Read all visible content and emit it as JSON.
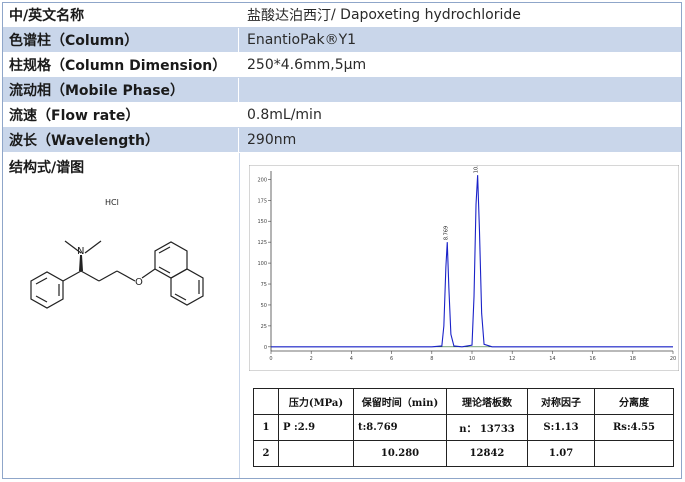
{
  "rows": [
    {
      "key": "中/英文名称",
      "value_cn": "盐酸达泊西汀",
      "value_en": "/ Dapoxeting hydrochloride"
    },
    {
      "key": "色谱柱（Column）",
      "value": "EnantioPak®Y1"
    },
    {
      "key": "柱规格（Column Dimension）",
      "value": "250*4.6mm,5μm"
    },
    {
      "key": "流动相（Mobile Phase）",
      "value": ""
    },
    {
      "key": "流速（Flow rate）",
      "value": "0.8mL/min"
    },
    {
      "key": "波长（Wavelength）",
      "value": "290nm"
    }
  ],
  "structure": {
    "label": "结构式/谱图",
    "salt": "HCl",
    "atom_n": "N",
    "atom_o": "O"
  },
  "chart_data": {
    "type": "line",
    "x": [
      0,
      1,
      2,
      3,
      4,
      5,
      6,
      7,
      8,
      8.5,
      8.6,
      8.7,
      8.769,
      8.85,
      8.95,
      9.1,
      9.5,
      10.0,
      10.1,
      10.2,
      10.28,
      10.37,
      10.48,
      10.6,
      11,
      12,
      13,
      14,
      15,
      16,
      17,
      18,
      19,
      20
    ],
    "y": [
      0,
      0,
      0,
      0,
      0,
      0,
      0,
      0,
      0,
      1,
      25,
      95,
      125,
      70,
      15,
      1,
      0,
      2,
      60,
      170,
      205,
      140,
      40,
      3,
      0,
      0,
      0,
      0,
      0,
      0,
      0,
      0,
      0,
      0
    ],
    "xlim": [
      0,
      20
    ],
    "ylim": [
      -5,
      210
    ],
    "yticks": [
      "0",
      "25",
      "50",
      "75",
      "100",
      "125",
      "150",
      "175",
      "200"
    ],
    "xticks": [
      "0",
      "2",
      "4",
      "6",
      "8",
      "10",
      "12",
      "14",
      "16",
      "18",
      "20"
    ],
    "peak_labels": [
      {
        "x": 8.769,
        "y": 125,
        "text": "8.769"
      },
      {
        "x": 10.28,
        "y": 205,
        "text": "10.280"
      }
    ]
  },
  "results": {
    "headers": [
      "",
      "压力(MPa)",
      "保留时间（min)",
      "理论塔板数",
      "对称因子",
      "分离度"
    ],
    "rows": [
      [
        "1",
        "P :2.9",
        "t:8.769",
        "n： 13733",
        "S:1.13",
        "Rs:4.55"
      ],
      [
        "2",
        "",
        "10.280",
        "12842",
        "1.07",
        ""
      ]
    ]
  },
  "colors": {
    "header_band": "#c9d6ea",
    "title_cn": "#1b56a5",
    "trace": "#1a22c8",
    "baseline": "#2a6a2a"
  }
}
